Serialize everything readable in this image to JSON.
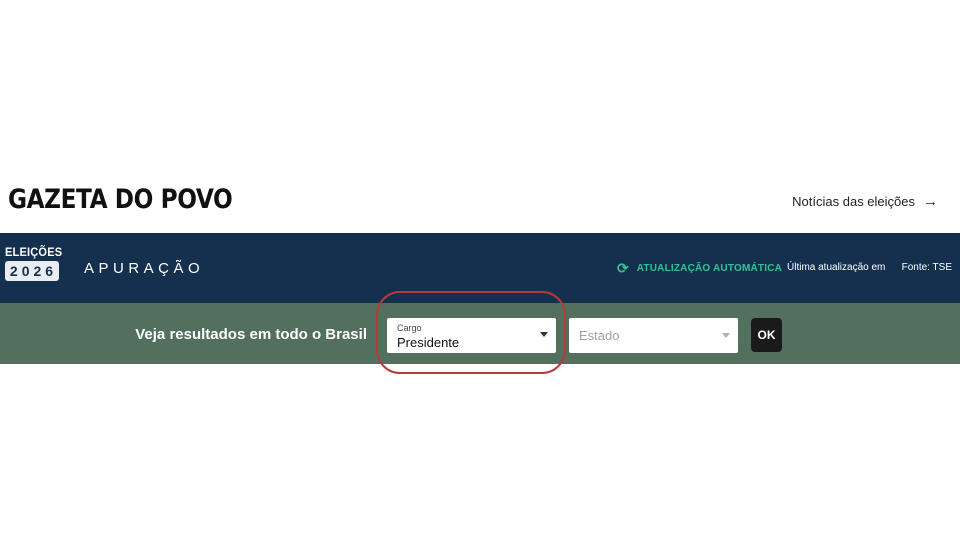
{
  "header": {
    "logo": "GAZETA DO POVO",
    "news_link": "Notícias das eleições",
    "news_arrow_icon": "arrow-right-icon"
  },
  "topbar": {
    "badge_title": "ELEIÇÕES",
    "badge_year": "2026",
    "section_title": "APURAÇÃO",
    "refresh_icon": "refresh-icon",
    "auto_update_label": "ATUALIZAÇÃO AUTOMÁTICA",
    "last_update": "Última atualização em",
    "source": "Fonte: TSE"
  },
  "filters": {
    "label": "Veja resultados em todo o Brasil",
    "cargo": {
      "caption": "Cargo",
      "value": "Presidente"
    },
    "estado": {
      "placeholder": "Estado"
    },
    "submit_label": "OK"
  },
  "colors": {
    "topbar_bg": "#15304f",
    "filterbar_bg": "#52705d",
    "accent_green": "#2fc592",
    "highlight_ring": "#b8393b"
  }
}
